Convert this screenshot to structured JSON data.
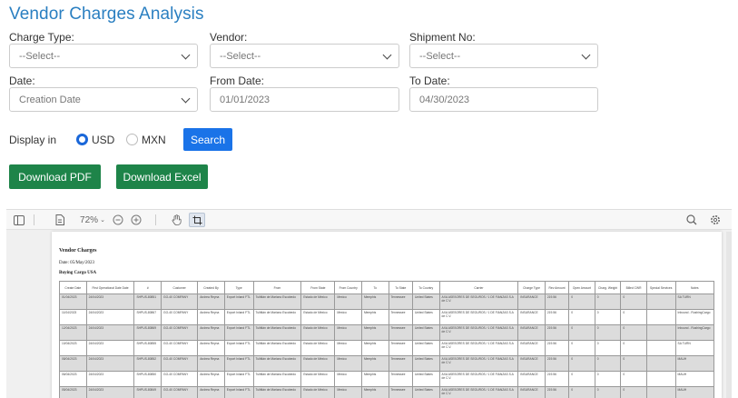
{
  "page": {
    "title": "Vendor Charges Analysis"
  },
  "filters": {
    "charge_type": {
      "label": "Charge Type:",
      "value": "--Select--"
    },
    "vendor": {
      "label": "Vendor:",
      "value": "--Select--"
    },
    "shipment_no": {
      "label": "Shipment No:",
      "value": "--Select--"
    },
    "date": {
      "label": "Date:",
      "value": "Creation Date"
    },
    "from_date": {
      "label": "From Date:",
      "value": "01/01/2023"
    },
    "to_date": {
      "label": "To Date:",
      "value": "04/30/2023"
    }
  },
  "display": {
    "label": "Display in",
    "options": [
      {
        "label": "USD",
        "selected": true
      },
      {
        "label": "MXN",
        "selected": false
      }
    ],
    "search_label": "Search"
  },
  "downloads": {
    "pdf_label": "Download PDF",
    "excel_label": "Download Excel"
  },
  "viewer": {
    "zoom": "72%",
    "icons": [
      "sidebar-toggle-icon",
      "page-icon",
      "zoom-out-icon",
      "zoom-in-icon",
      "hand-tool-icon",
      "select-tool-icon",
      "search-icon",
      "settings-icon"
    ]
  },
  "report": {
    "title": "Vendor Charges",
    "date_line": "Date: 05/May/2023",
    "vendor_line": "Buying Cargo USA",
    "columns": [
      "Create Date",
      "First Operational Date Date",
      "#",
      "Customer",
      "Created By",
      "Type",
      "From",
      "From State",
      "From Country",
      "To",
      "To State",
      "To Country",
      "Carrier",
      "Charge Type",
      "Rev Amount",
      "Open Amount",
      "Charg. Weight",
      "Billed CWR",
      "Special Services",
      "Notes"
    ],
    "rows": [
      [
        "01/04/2023",
        "24/04/2023",
        "SHPUS-80851",
        "GO-40 COMPANY",
        "Andrea Reyna",
        "Export Inland FTL",
        "Tultitlán de Mariano Escobedo",
        "Estado de México",
        "Mexico",
        "Memphis",
        "Tennessee",
        "United States",
        "AXA ASESORES DE SEGUROS / 1 DE FIANZAS S.A de C.V.",
        "INSURANCE",
        "219.56",
        "0",
        "0",
        "0",
        "",
        "SA TURN"
      ],
      [
        "11/04/2023",
        "24/04/2023",
        "SHPUS-80867",
        "GO-40 COMPANY",
        "Andrea Reyna",
        "Export Inland FTL",
        "Tultitlán de Mariano Escobedo",
        "Estado de México",
        "Mexico",
        "Memphis",
        "Tennessee",
        "United States",
        "AXA ASESORES DE SEGUROS / 1 DE FIANZAS S.A de C.V.",
        "INSURANCE",
        "219.56",
        "0",
        "0",
        "0",
        "",
        "Inbound - RushingCargo"
      ],
      [
        "12/04/2023",
        "24/04/2023",
        "SHPUS-80869",
        "GO-40 COMPANY",
        "Andrea Reyna",
        "Export Inland FTL",
        "Tultitlán de Mariano Escobedo",
        "Estado de México",
        "Mexico",
        "Memphis",
        "Tennessee",
        "United States",
        "AXA ASESORES DE SEGUROS / 1 DE FIANZAS S.A de C.V.",
        "INSURANCE",
        "219.56",
        "0",
        "0",
        "0",
        "",
        "Inbound - RushingCargo"
      ],
      [
        "10/04/2023",
        "24/04/2023",
        "SHPUS-80855",
        "GO-40 COMPANY",
        "Andrea Reyna",
        "Export Inland FTL",
        "Tultitlán de Mariano Escobedo",
        "Estado de México",
        "Mexico",
        "Memphis",
        "Tennessee",
        "United States",
        "AXA ASESORES DE SEGUROS / 1 DE FIANZAS S.A de C.V.",
        "INSURANCE",
        "219.56",
        "0",
        "0",
        "0",
        "",
        "SA TURN"
      ],
      [
        "08/04/2023",
        "24/04/2023",
        "SHPUS-80852",
        "GO-40 COMPANY",
        "Andrea Reyna",
        "Export Inland FTL",
        "Tultitlán de Mariano Escobedo",
        "Estado de México",
        "Mexico",
        "Memphis",
        "Tennessee",
        "United States",
        "AXA ASESORES DE SEGUROS / 1 DE FIANZAS S.A de C.V.",
        "INSURANCE",
        "219.56",
        "0",
        "0",
        "0",
        "",
        "MAUH"
      ],
      [
        "06/04/2023",
        "24/04/2023",
        "SHPUS-80850",
        "GO-40 COMPANY",
        "Andrea Reyna",
        "Export Inland FTL",
        "Tultitlán de Mariano Escobedo",
        "Estado de México",
        "Mexico",
        "Memphis",
        "Tennessee",
        "United States",
        "AXA ASESORES DE SEGUROS / 1 DE FIANZAS S.A de C.V.",
        "INSURANCE",
        "219.56",
        "0",
        "0",
        "0",
        "",
        "MAUH"
      ],
      [
        "05/04/2023",
        "24/04/2023",
        "SHPUS-80849",
        "GO-40 COMPANY",
        "Andrea Reyna",
        "Export Inland FTL",
        "Tultitlán de Mariano Escobedo",
        "Estado de México",
        "Mexico",
        "Memphis",
        "Tennessee",
        "United States",
        "AXA ASESORES DE SEGUROS / 1 DE FIANZAS S.A de C.V.",
        "INSURANCE",
        "219.56",
        "0",
        "0",
        "0",
        "",
        "MAUH"
      ]
    ]
  }
}
